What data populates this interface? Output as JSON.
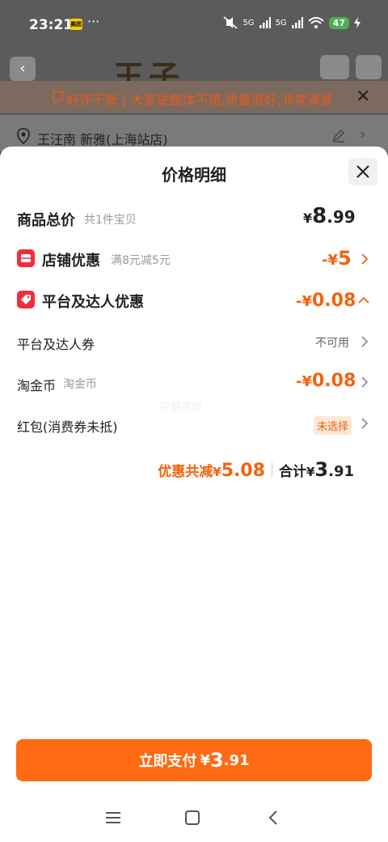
{
  "status_bar": {
    "time": "23:21",
    "app_badge": "美团",
    "more": "···",
    "signal_1": "5G",
    "signal_2": "5G",
    "battery": "47"
  },
  "background": {
    "notice": "好评不断 | 大家说整体不错,质量很好,非常满意",
    "address": "王汪南 新雅(上海站店)",
    "logo_text": "王子"
  },
  "sheet": {
    "title": "价格明细",
    "total": {
      "label": "商品总价",
      "sub": "共1件宝贝",
      "yen": "¥",
      "int": "8",
      "dec": ".99"
    },
    "store_discount": {
      "label": "店铺优惠",
      "sub": "满8元减5元",
      "value_prefix": "-¥",
      "value": "5"
    },
    "platform_discount": {
      "label": "平台及达人优惠",
      "value_prefix": "-¥",
      "value": "0.08"
    },
    "platform_coupon": {
      "label": "平台及达人券",
      "status": "不可用"
    },
    "taojin": {
      "label": "淘金币",
      "sub": "淘金币",
      "value_prefix": "-¥",
      "value": "0.08"
    },
    "red_packet": {
      "label": "红包(消费券未抵)",
      "status": "未选择"
    },
    "watermark": "只猫京智",
    "summary": {
      "discount_label": "优惠共减",
      "discount_yen": "¥",
      "discount_value": "5.08",
      "total_label": "合计",
      "total_yen": "¥",
      "total_int": "3",
      "total_dec": ".91"
    }
  },
  "pay_button": {
    "label": "立即支付",
    "yen": "¥",
    "int": "3",
    "dec": ".91"
  },
  "colors": {
    "accent": "#f2620f",
    "button": "#ff6a12",
    "red_icon": "#ef2e3c"
  }
}
